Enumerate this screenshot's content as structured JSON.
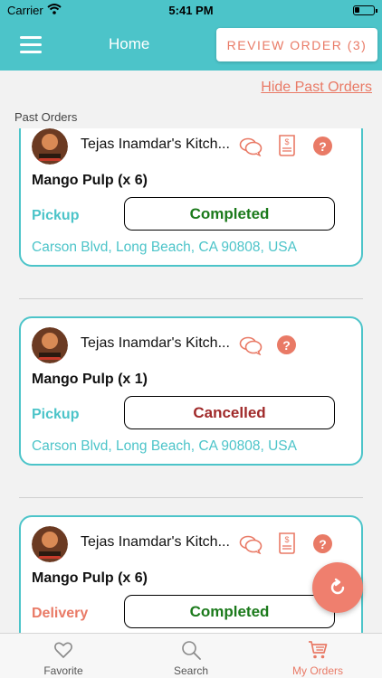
{
  "status_bar": {
    "carrier": "Carrier",
    "time": "5:41 PM"
  },
  "header": {
    "title": "Home",
    "review_button": "REVIEW ORDER (3)"
  },
  "hide_past_orders_link": "Hide Past Orders",
  "section_label": "Past Orders",
  "orders": [
    {
      "kitchen": "Tejas Inamdar's Kitch...",
      "item": "Mango Pulp  (x 6)",
      "mode": "Pickup",
      "status": "Completed",
      "address": "Carson Blvd, Long Beach, CA 90808, USA"
    },
    {
      "kitchen": "Tejas Inamdar's Kitch...",
      "item": "Mango Pulp  (x 1)",
      "mode": "Pickup",
      "status": "Cancelled",
      "address": "Carson Blvd, Long Beach, CA 90808, USA"
    },
    {
      "kitchen": "Tejas Inamdar's Kitch...",
      "item": "Mango Pulp  (x 6)",
      "mode": "Delivery",
      "status": "Completed",
      "address": ""
    }
  ],
  "help_glyph": "?",
  "tabs": [
    {
      "label": "Favorite",
      "icon": "heart-icon"
    },
    {
      "label": "Search",
      "icon": "search-icon"
    },
    {
      "label": "My Orders",
      "icon": "cart-icon"
    }
  ],
  "colors": {
    "accent_teal": "#4cc4c9",
    "accent_coral": "#e97a66",
    "status_completed": "#1b7a1b",
    "status_cancelled": "#a02a2a",
    "mode_pickup": "#4cc4c9",
    "mode_delivery": "#e97a66"
  }
}
